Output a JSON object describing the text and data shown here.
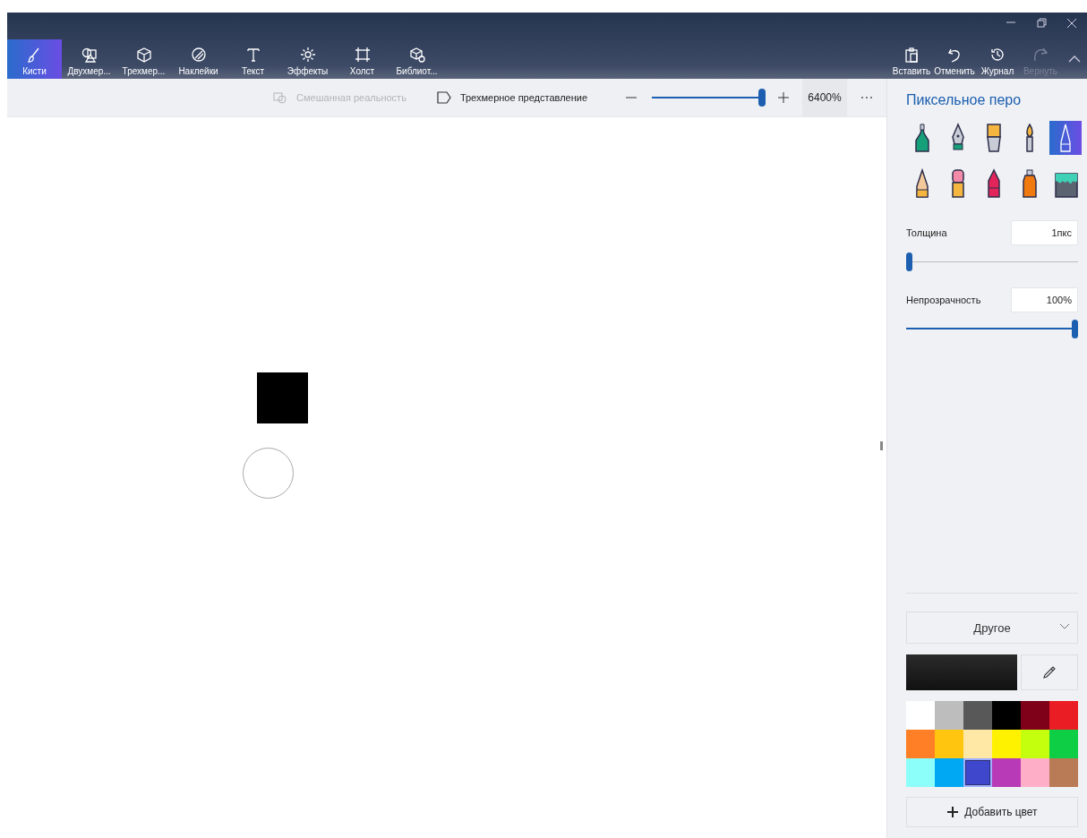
{
  "ribbon": {
    "tabs": [
      {
        "kind": "brushes",
        "label": "Кисти",
        "selected": true
      },
      {
        "kind": "shapes2d",
        "label": "Двухмер...",
        "selected": false
      },
      {
        "kind": "shapes3d",
        "label": "Трехмер...",
        "selected": false
      },
      {
        "kind": "stickers",
        "label": "Наклейки",
        "selected": false
      },
      {
        "kind": "text",
        "label": "Текст",
        "selected": false
      },
      {
        "kind": "effects",
        "label": "Эффекты",
        "selected": false
      },
      {
        "kind": "canvas",
        "label": "Холст",
        "selected": false
      },
      {
        "kind": "library",
        "label": "Библиот...",
        "selected": false
      }
    ],
    "actions": [
      {
        "kind": "paste",
        "label": "Вставить",
        "disabled": false
      },
      {
        "kind": "undo",
        "label": "Отменить",
        "disabled": false
      },
      {
        "kind": "history",
        "label": "Журнал",
        "disabled": false
      },
      {
        "kind": "redo",
        "label": "Вернуть",
        "disabled": true
      }
    ]
  },
  "view_bar": {
    "mixed_reality": {
      "label": "Смешанная реальность",
      "disabled": true
    },
    "view_3d": {
      "label": "Трехмерное представление"
    },
    "zoom": {
      "level": 1,
      "reading": "6400%"
    }
  },
  "panel": {
    "title": "Пиксельное перо",
    "brushes": [
      {
        "kind": "marker",
        "selected": false
      },
      {
        "kind": "pen",
        "selected": false
      },
      {
        "kind": "oil",
        "selected": false
      },
      {
        "kind": "watercolor",
        "selected": false
      },
      {
        "kind": "pixel",
        "selected": true
      },
      {
        "kind": "pencil",
        "selected": false
      },
      {
        "kind": "eraser",
        "selected": false
      },
      {
        "kind": "crayon",
        "selected": false
      },
      {
        "kind": "spray",
        "selected": false
      },
      {
        "kind": "fill",
        "selected": false
      }
    ],
    "thickness": {
      "label": "Толщина",
      "value": "1пкс",
      "level": 0
    },
    "opacity": {
      "label": "Непрозрачность",
      "value": "100%",
      "level": 1
    },
    "color_mode": "Другое",
    "palette": [
      {
        "color": "#ffffff",
        "selected": false
      },
      {
        "color": "#bdbdbd",
        "selected": false
      },
      {
        "color": "#585858",
        "selected": false
      },
      {
        "color": "#000000",
        "selected": false
      },
      {
        "color": "#7e0019",
        "selected": false
      },
      {
        "color": "#ea1c24",
        "selected": false
      },
      {
        "color": "#ff7f27",
        "selected": false
      },
      {
        "color": "#ffc50f",
        "selected": false
      },
      {
        "color": "#ffe8a6",
        "selected": false
      },
      {
        "color": "#fff200",
        "selected": false
      },
      {
        "color": "#c4ff0e",
        "selected": false
      },
      {
        "color": "#0ece46",
        "selected": false
      },
      {
        "color": "#8cfffb",
        "selected": false
      },
      {
        "color": "#00a8f3",
        "selected": false
      },
      {
        "color": "#3f48cc",
        "selected": true
      },
      {
        "color": "#b83ab7",
        "selected": false
      },
      {
        "color": "#ffaec8",
        "selected": false
      },
      {
        "color": "#b97b56",
        "selected": false
      }
    ],
    "add_color": "Добавить цвет"
  }
}
